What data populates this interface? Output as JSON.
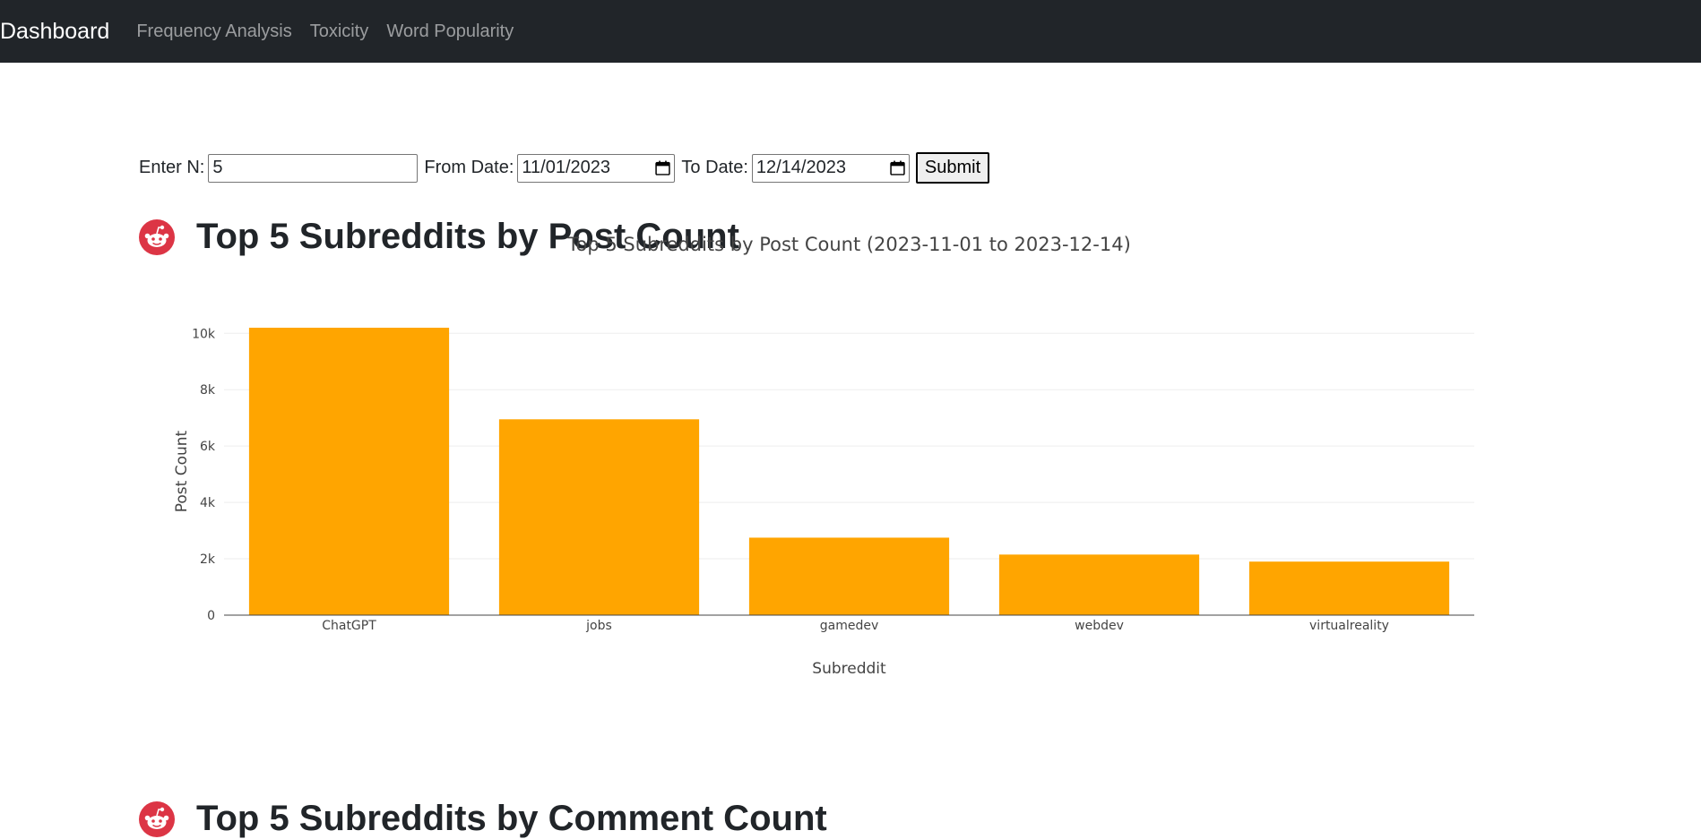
{
  "nav": {
    "brand": "Dashboard",
    "links": [
      "Frequency Analysis",
      "Toxicity",
      "Word Popularity"
    ]
  },
  "form": {
    "n_label": "Enter N:",
    "n_value": "5",
    "from_label": "From Date:",
    "from_value": "11/01/2023",
    "to_label": "To Date:",
    "to_value": "12/14/2023",
    "submit_label": "Submit"
  },
  "sections": [
    {
      "title": "Top 5 Subreddits by Post Count",
      "icon": "reddit-icon"
    },
    {
      "title": "Top 5 Subreddits by Comment Count",
      "icon": "reddit-icon"
    }
  ],
  "colors": {
    "navbar": "#212529",
    "bar": "#FFA500",
    "reddit": "#DC3545"
  },
  "chart_data": {
    "type": "bar",
    "title": "Top 5 Subreddits by Post Count (2023-11-01 to 2023-12-14)",
    "xlabel": "Subreddit",
    "ylabel": "Post Count",
    "categories": [
      "ChatGPT",
      "jobs",
      "gamedev",
      "webdev",
      "virtualreality"
    ],
    "values": [
      10200,
      6950,
      2750,
      2150,
      1900
    ],
    "ylim": [
      0,
      10200
    ],
    "yticks": [
      0,
      2000,
      4000,
      6000,
      8000,
      10000
    ],
    "ytick_labels": [
      "0",
      "2k",
      "4k",
      "6k",
      "8k",
      "10k"
    ],
    "grid": true
  }
}
